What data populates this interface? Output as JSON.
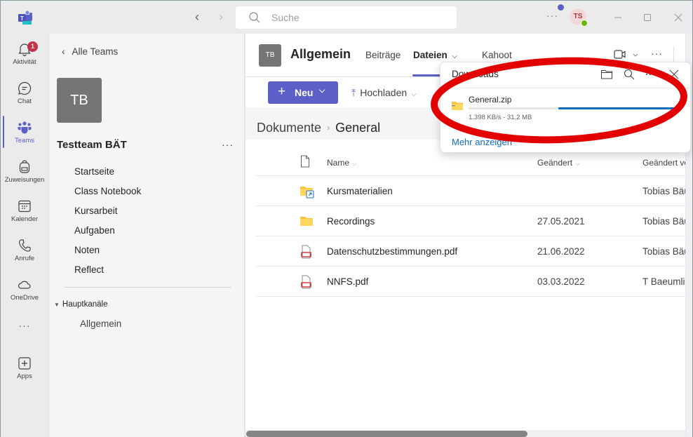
{
  "titlebar": {
    "search_placeholder": "Suche",
    "more_label": "···",
    "avatar_initials": "TS",
    "presence": "available"
  },
  "rail": {
    "items": [
      {
        "label": "Aktivität",
        "icon": "bell-icon",
        "badge": "1"
      },
      {
        "label": "Chat",
        "icon": "chat-icon"
      },
      {
        "label": "Teams",
        "icon": "teams-icon",
        "active": true
      },
      {
        "label": "Zuweisungen",
        "icon": "backpack-icon"
      },
      {
        "label": "Kalender",
        "icon": "calendar-icon"
      },
      {
        "label": "Anrufe",
        "icon": "phone-icon"
      },
      {
        "label": "OneDrive",
        "icon": "cloud-icon"
      },
      {
        "label": "···",
        "icon": "more-icon"
      },
      {
        "label": "Apps",
        "icon": "add-apps-icon"
      }
    ]
  },
  "team_panel": {
    "back_label": "Alle Teams",
    "team_initials": "TB",
    "team_name": "Testteam BÄT",
    "more_label": "···",
    "tabs": [
      "Startseite",
      "Class Notebook",
      "Kursarbeit",
      "Aufgaben",
      "Noten",
      "Reflect"
    ],
    "section_label": "Hauptkanäle",
    "channels": [
      "Allgemein"
    ]
  },
  "channel": {
    "initials": "TB",
    "title": "Allgemein",
    "tabs": [
      {
        "label": "Beiträge"
      },
      {
        "label": "Dateien",
        "active": true,
        "dropdown": "⌄"
      },
      {
        "label": "Kahoot"
      }
    ],
    "more_label": "···"
  },
  "toolbar": {
    "new_label": "Neu",
    "upload_label": "Hochladen"
  },
  "breadcrumb": {
    "root": "Dokumente",
    "separator": "›",
    "current": "General"
  },
  "files": {
    "columns": {
      "name": "Name",
      "modified": "Geändert",
      "modified_by": "Geändert von"
    },
    "rows": [
      {
        "name": "Kursmaterialien",
        "type": "folder-shortcut",
        "modified": "",
        "modified_by": "Tobias Bäumlin"
      },
      {
        "name": "Recordings",
        "type": "folder",
        "modified": "27.05.2021",
        "modified_by": "Tobias Bäumlin"
      },
      {
        "name": "Datenschutzbestimmungen.pdf",
        "type": "pdf",
        "modified": "21.06.2022",
        "modified_by": "Tobias Bäumlin"
      },
      {
        "name": "NNFS.pdf",
        "type": "pdf",
        "modified": "03.03.2022",
        "modified_by": "T Baeumlin"
      }
    ]
  },
  "downloads": {
    "title": "Downloads",
    "file_name": "General.zip",
    "meta": "1.398 KB/s - 31,2 MB",
    "progress_segment_start": 0.42,
    "progress_segment_end": 1.0,
    "more_label": "Mehr anzeigen",
    "colors": {
      "progress": "#0f6cbd",
      "annotation": "#e30000"
    }
  },
  "colors": {
    "brand": "#5b5fc7",
    "badge": "#c4314b"
  }
}
